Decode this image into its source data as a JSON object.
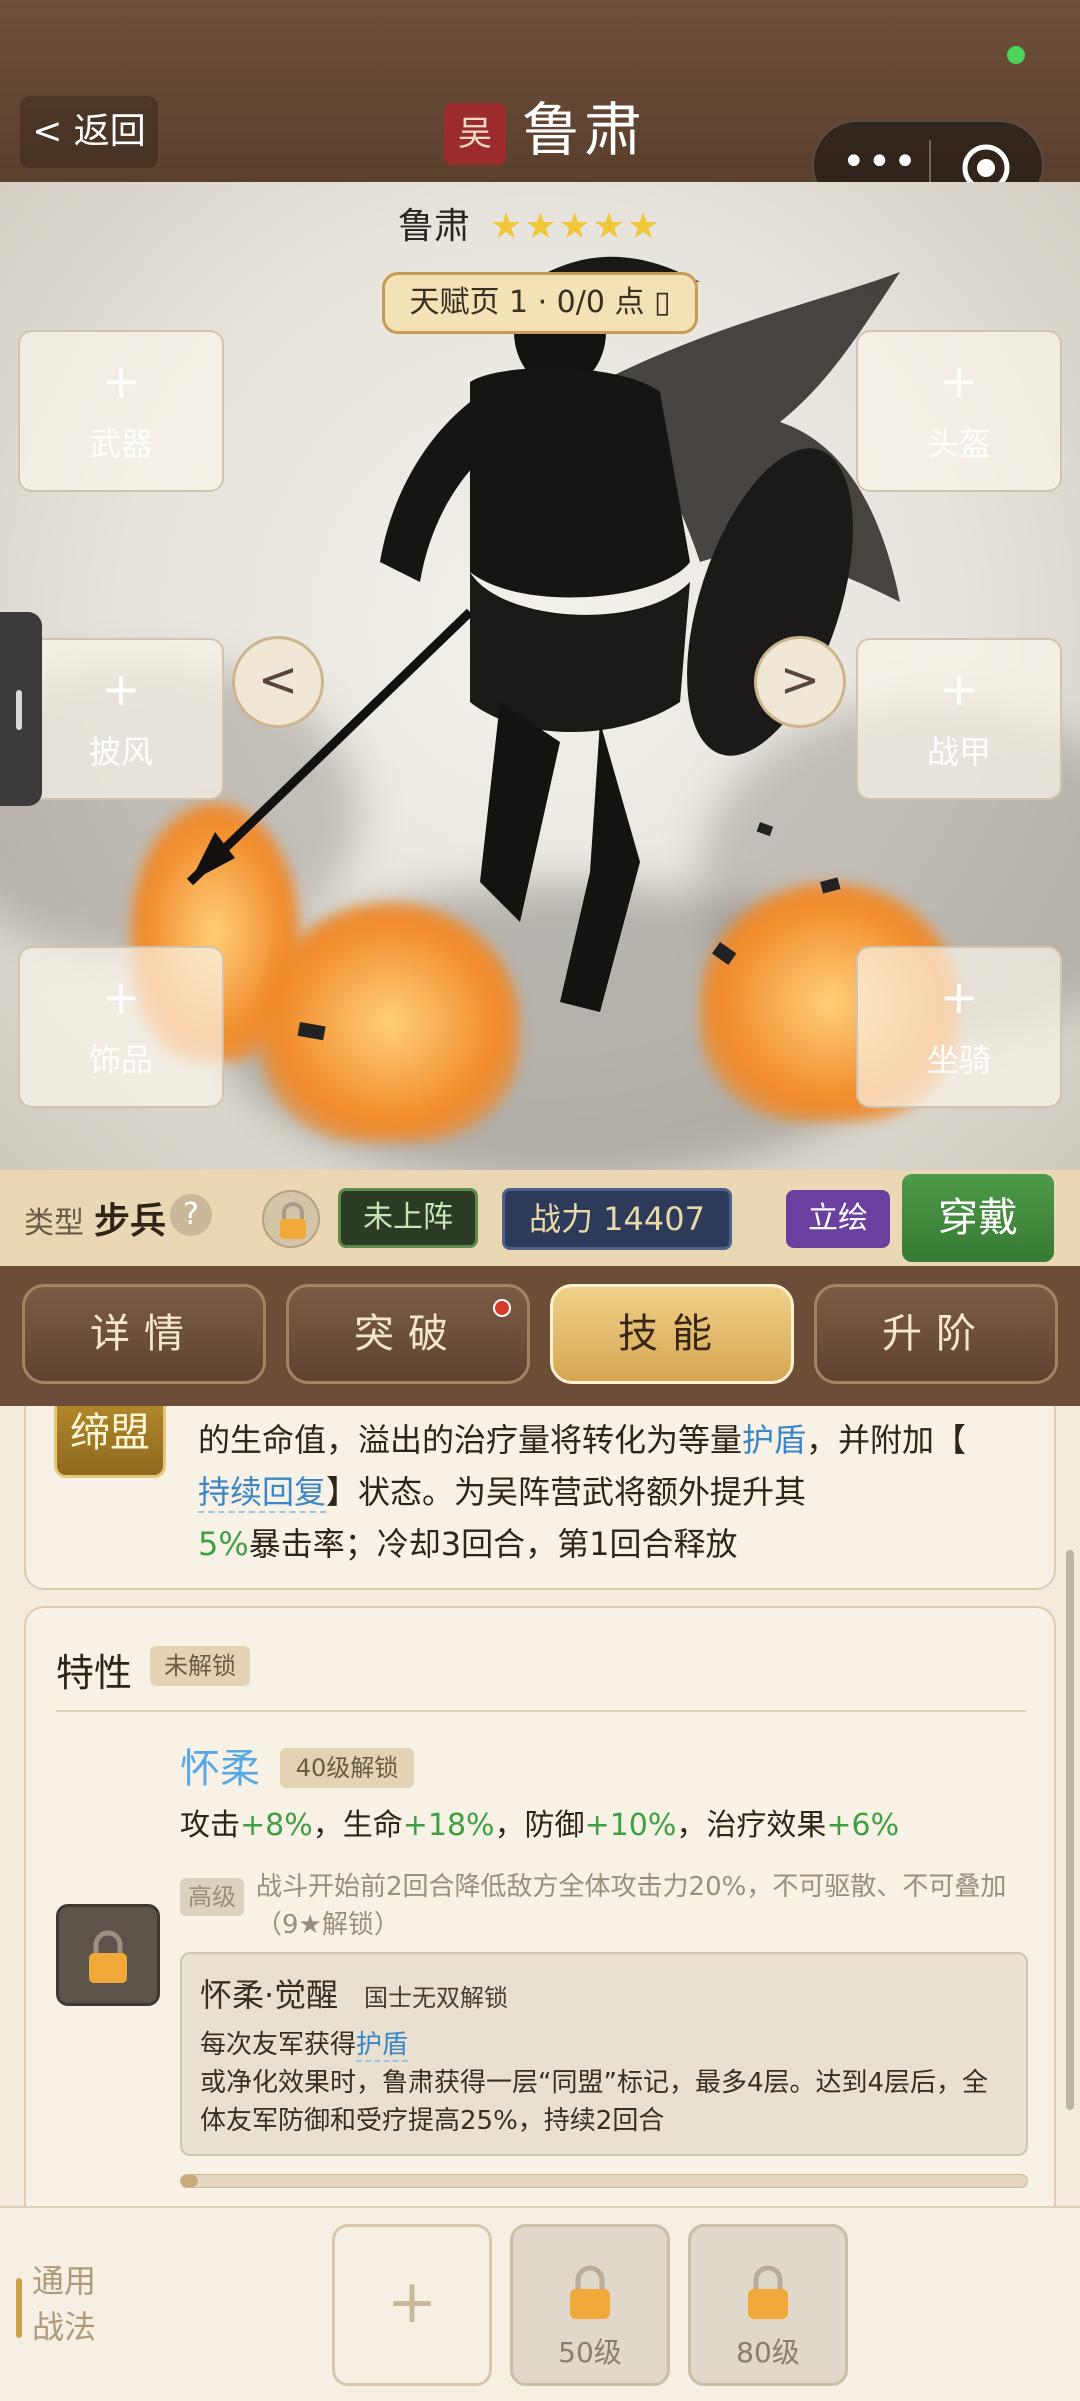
{
  "topbar": {
    "back_label": "< 返回",
    "faction": "吴",
    "title": "鲁肃"
  },
  "hero": {
    "name": "鲁肃",
    "stars": "★★★★★",
    "talent_button": "天赋页 1 · 0/0 点 ▯",
    "slots": {
      "weapon": "武器",
      "helmet": "头盔",
      "cloak": "披风",
      "armor": "战甲",
      "accessory": "饰品",
      "mount": "坐骑"
    },
    "prev_arrow": "<",
    "next_arrow": ">"
  },
  "info": {
    "type_label": "类型",
    "type_value": "步兵",
    "help": "?",
    "status": "未上阵",
    "power": "战力  14407",
    "portrait": "立绘",
    "wear": "穿戴"
  },
  "tabs": [
    "详情",
    "突破",
    "技能",
    "升阶"
  ],
  "skill": {
    "badge": "缔盟",
    "text_1": "的生命值，溢出的治疗量将转化为等量",
    "link_1": "护盾",
    "text_2": "，并附加【",
    "link_2": "持续回复",
    "text_3": "】状态。为吴阵营武将额外提升其",
    "pct": "5%",
    "text_4": "暴击率；冷却3回合，第1回合释放"
  },
  "trait": {
    "title": "特性",
    "locked_tag": "未解锁",
    "name": "怀柔",
    "unlock_tag": "40级解锁",
    "stats": {
      "atk_label": "攻击",
      "atk": "+8%",
      "hp_label": "，生命",
      "hp": "+18%",
      "def_label": "，防御",
      "def": "+10%",
      "heal_label": "，治疗效果",
      "heal": "+6%"
    },
    "advanced_tag": "高级",
    "advanced_text": "战斗开始前2回合降低敌方全体攻击力20%，不可驱散、不可叠加（9★解锁）",
    "awaken_title": "怀柔·觉醒",
    "awaken_sub": "国士无双解锁",
    "awaken_text_1": "每次友军获得",
    "awaken_link": "护盾",
    "awaken_text_2": "或净化效果时，鲁肃获得一层“同盟”标记，最多4层。达到4层后，全体友军防御和受疗提高25%，持续2回合",
    "progress": 0.02
  },
  "bottom": {
    "label": "通用战法",
    "add": "+",
    "slot_2_level": "50级",
    "slot_3_level": "80级"
  },
  "colors": {
    "topbar": "#6e4f3a",
    "tab_active": "#e3b866",
    "wear_button": "#4a8f45",
    "link_blue": "#3b86c7",
    "stat_green": "#3ea043"
  }
}
